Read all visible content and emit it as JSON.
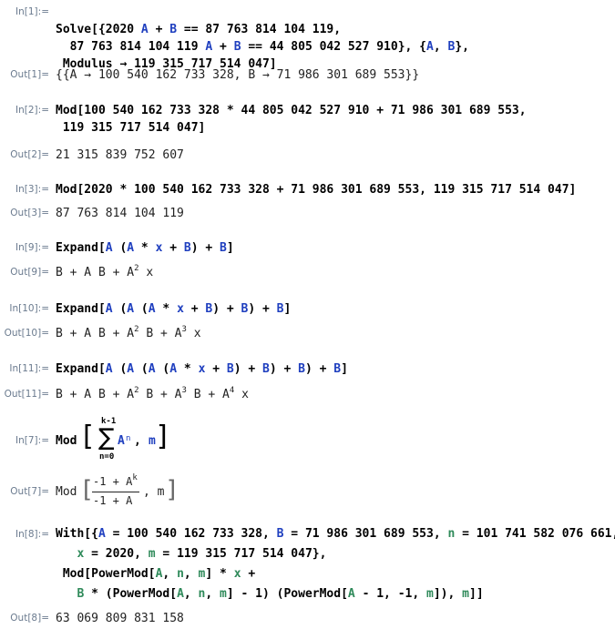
{
  "cells": {
    "in1": {
      "label": "In[1]:=",
      "l1a": "Solve[{2020 ",
      "A1": "A",
      "l1b": " + ",
      "B1": "B",
      "l1c": " == 87 763 814 104 119,",
      "l2a": "87 763 814 104 119 ",
      "A2": "A",
      "l2b": " + ",
      "B2": "B",
      "l2c": " == 44 805 042 527 910}, {",
      "A3": "A",
      "l2d": ", ",
      "B3": "B",
      "l2e": "},",
      "l3": "Modulus → 119 315 717 514 047]"
    },
    "out1": {
      "label": "Out[1]=",
      "text": "{{A → 100 540 162 733 328, B → 71 986 301 689 553}}"
    },
    "in2": {
      "label": "In[2]:=",
      "l1": "Mod[100 540 162 733 328 * 44 805 042 527 910 + 71 986 301 689 553,",
      "l2": "119 315 717 514 047]"
    },
    "out2": {
      "label": "Out[2]=",
      "text": "21 315 839 752 607"
    },
    "in3": {
      "label": "In[3]:=",
      "text": "Mod[2020 * 100 540 162 733 328 + 71 986 301 689 553, 119 315 717 514 047]"
    },
    "out3": {
      "label": "Out[3]=",
      "text": "87 763 814 104 119"
    },
    "in9": {
      "label": "In[9]:=",
      "fn": "Expand[",
      "A1": "A",
      "p1": " (",
      "A2": "A",
      "p2": " * ",
      "x": "x",
      "p3": " + ",
      "B1": "B",
      "p4": ") + ",
      "B2": "B",
      "end": "]"
    },
    "out9": {
      "label": "Out[9]=",
      "a": "B + A B + A",
      "e1": "2",
      "b": " x"
    },
    "in10": {
      "label": "In[10]:=",
      "fn": "Expand[",
      "A1": "A",
      "p1": " (",
      "A2": "A",
      "p2": " (",
      "A3": "A",
      "p3": " * ",
      "x": "x",
      "p4": " + ",
      "B1": "B",
      "p5": ") + ",
      "B2": "B",
      "p6": ") + ",
      "B3": "B",
      "end": "]"
    },
    "out10": {
      "label": "Out[10]=",
      "a": "B + A B + A",
      "e1": "2",
      "b": " B + A",
      "e2": "3",
      "c": " x"
    },
    "in11": {
      "label": "In[11]:=",
      "fn": "Expand[",
      "A1": "A",
      "p1": " (",
      "A2": "A",
      "p2": " (",
      "A3": "A",
      "p3": " (",
      "A4": "A",
      "p4": " * ",
      "x": "x",
      "p5": " + ",
      "B1": "B",
      "p6": ") + ",
      "B2": "B",
      "p7": ") + ",
      "B3": "B",
      "p8": ") + ",
      "B4": "B",
      "end": "]"
    },
    "out11": {
      "label": "Out[11]=",
      "a": "B + A B + A",
      "e1": "2",
      "b": " B + A",
      "e2": "3",
      "c": " B + A",
      "e3": "4",
      "d": " x"
    },
    "in7": {
      "label": "In[7]:=",
      "fn": "Mod",
      "upper": "k-1",
      "lower": "n=0",
      "A": "A",
      "n": "n",
      "sep": ", ",
      "m": "m"
    },
    "out7": {
      "label": "Out[7]=",
      "fn": "Mod",
      "num": "-1 + A",
      "numexp": "k",
      "den": "-1 + A",
      "sep": ", m"
    },
    "in8": {
      "label": "In[8]:=",
      "l1a": "With[{",
      "A1": "A",
      "l1b": " = 100 540 162 733 328, ",
      "B1": "B",
      "l1c": " = 71 986 301 689 553, ",
      "n1": "n",
      "l1d": " = 101 741 582 076 661,",
      "x1": "x",
      "l2a": " = 2020, ",
      "m1": "m",
      "l2b": " = 119 315 717 514 047},",
      "l3a": "Mod[PowerMod[",
      "A2": "A",
      "l3b": ", ",
      "n2": "n",
      "l3c": ", ",
      "m2": "m",
      "l3d": "] * ",
      "x2": "x",
      "l3e": " +",
      "B2": "B",
      "l4a": " * (PowerMod[",
      "A3": "A",
      "l4b": ", ",
      "n3": "n",
      "l4c": ", ",
      "m3": "m",
      "l4d": "] - 1) (PowerMod[",
      "A4": "A",
      "l4e": " - 1, -1, ",
      "m4": "m",
      "l4f": "]), ",
      "m5": "m",
      "l4g": "]]"
    },
    "out8": {
      "label": "Out[8]=",
      "text": "63 069 809 831 158"
    }
  },
  "colors": {
    "label": "#6b7b8f",
    "symbol": "#1f3fbf",
    "local": "#2f8a5a"
  }
}
